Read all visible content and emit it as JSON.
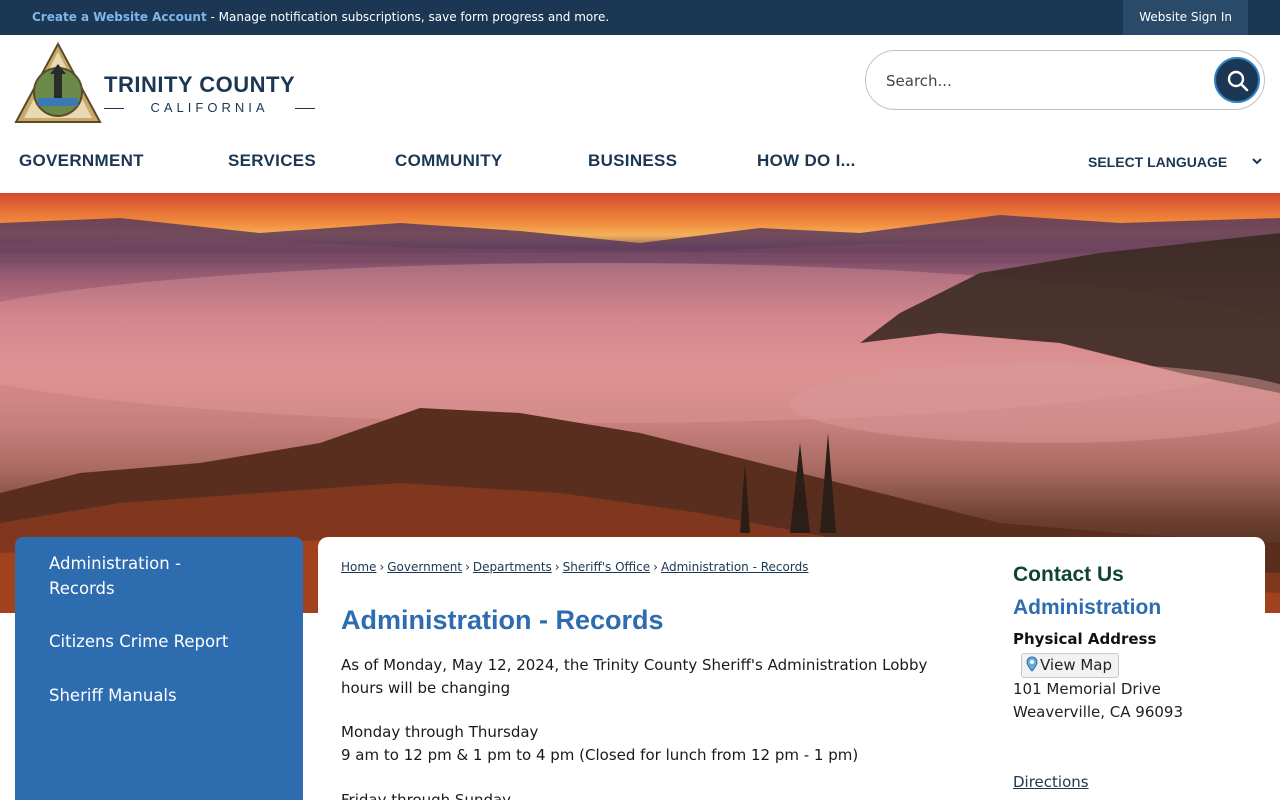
{
  "topbar": {
    "create_account_link": "Create a Website Account",
    "create_account_text": " - Manage notification subscriptions, save form progress and more.",
    "sign_in": "Website Sign In"
  },
  "logo": {
    "name": "TRINITY COUNTY",
    "state": "CALIFORNIA"
  },
  "search": {
    "placeholder": "Search..."
  },
  "nav": {
    "items": [
      "GOVERNMENT",
      "SERVICES",
      "COMMUNITY",
      "BUSINESS",
      "HOW DO I..."
    ],
    "language": "SELECT LANGUAGE"
  },
  "sidebar": {
    "items": [
      {
        "label": "Administration - Records"
      },
      {
        "label": "Citizens Crime Report"
      },
      {
        "label": "Sheriff Manuals"
      }
    ]
  },
  "breadcrumb": [
    "Home",
    "Government",
    "Departments",
    "Sheriff's Office",
    "Administration - Records"
  ],
  "page": {
    "title": "Administration - Records",
    "paragraphs": [
      "As of Monday, May 12, 2024, the Trinity County Sheriff's Administration Lobby hours will be changing",
      "Monday through Thursday",
      "9 am to 12 pm & 1 pm to 4 pm (Closed for lunch from 12 pm - 1 pm)",
      "Friday through Sunday"
    ]
  },
  "contact": {
    "heading": "Contact Us",
    "department": "Administration",
    "address_label": "Physical Address",
    "view_map": "View Map",
    "address_line1": "101 Memorial Drive",
    "address_line2": "Weaverville, CA 96093",
    "directions": "Directions"
  },
  "colors": {
    "navy": "#1c3753",
    "brand_blue": "#2e6cb0",
    "contact_green": "#0f4530"
  },
  "icons": {
    "search": "search-icon",
    "chevron": "chevron-down-icon",
    "map_pin": "map-pin-icon"
  }
}
